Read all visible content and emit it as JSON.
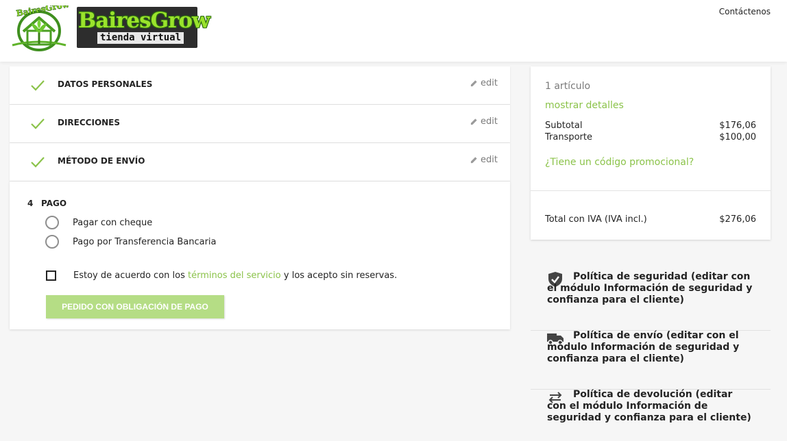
{
  "header": {
    "logo": {
      "brand": "BairesGrow",
      "tagline": "tienda virtual"
    },
    "contact_label": "Contáctenos"
  },
  "steps": [
    {
      "title": "Datos personales",
      "edit_label": "edit"
    },
    {
      "title": "Direcciones",
      "edit_label": "edit"
    },
    {
      "title": "Método de envío",
      "edit_label": "edit"
    }
  ],
  "payment": {
    "number": "4",
    "title": "Pago",
    "options": [
      {
        "label": "Pagar con cheque"
      },
      {
        "label": "Pago por Transferencia Bancaria"
      }
    ],
    "terms_prefix": "Estoy de acuerdo con los",
    "terms_link": "términos del servicio",
    "terms_suffix": "y los acepto sin reservas.",
    "order_button": "Pedido con obligación de pago"
  },
  "summary": {
    "items_count": "1 artículo",
    "show_details": "mostrar detalles",
    "subtotal_label": "Subtotal",
    "subtotal_value": "$176,06",
    "shipping_label": "Transporte",
    "shipping_value": "$100,00",
    "promo_label": "¿Tiene un código promocional?",
    "total_label": "Total con IVA (IVA incl.)",
    "total_value": "$276,06"
  },
  "reassurance": [
    {
      "icon": "shield-check-icon",
      "text": "Política de seguridad (editar con el módulo Información de seguridad y confianza para el cliente)"
    },
    {
      "icon": "truck-icon",
      "text": "Política de envío (editar con el módulo Información de seguridad y confianza para el cliente)"
    },
    {
      "icon": "swap-arrows-icon",
      "text": "Política de devolución (editar con el módulo Información de seguridad y confianza para el cliente)"
    }
  ],
  "colors": {
    "accent": "#8bc34a",
    "button_disabled": "#b5dd85",
    "text": "#232323",
    "muted": "#7a7a7a"
  }
}
